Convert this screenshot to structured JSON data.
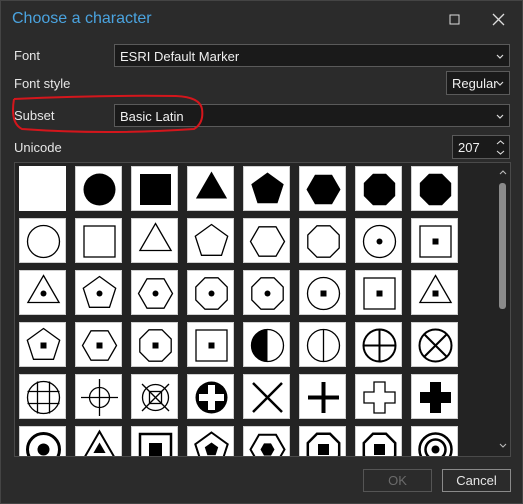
{
  "window": {
    "title": "Choose a character",
    "accent_color": "#4aa3df",
    "buttons": [
      "maximize-icon",
      "close-icon"
    ]
  },
  "form": {
    "font": {
      "label": "Font",
      "value": "ESRI Default Marker"
    },
    "font_style": {
      "label": "Font style",
      "value": "Regular"
    },
    "subset": {
      "label": "Subset",
      "value": "Basic Latin",
      "annotation_color": "#d4161c"
    },
    "unicode": {
      "label": "Unicode",
      "value": "207"
    }
  },
  "glyph_grid": {
    "columns": 9,
    "rows": [
      [
        "square-filled-white",
        "circle-filled",
        "square-filled",
        "triangle-filled",
        "pentagon-filled",
        "hexagon-filled",
        "octagon-filled",
        "octagon-filled-2"
      ],
      [
        "circle-outline",
        "square-outline",
        "triangle-outline",
        "pentagon-outline",
        "hexagon-outline",
        "octagon-outline",
        "circle-dot",
        "square-dot"
      ],
      [
        "triangle-dot",
        "pentagon-dot",
        "hexagon-dot",
        "octagon-dot",
        "octagon-dot-2",
        "circle-square",
        "square-square",
        "triangle-square"
      ],
      [
        "pentagon-square",
        "hexagon-square",
        "octagon-square",
        "square-square-2",
        "circle-half",
        "circle-vline",
        "circle-cross",
        "circle-x"
      ],
      [
        "circle-grid",
        "crosshair",
        "circle-x-square",
        "circle-cross-filled",
        "x-mark",
        "plus",
        "cross-outline",
        "cross-filled"
      ],
      [
        "circle-bullseye",
        "triangle-triangle",
        "square-square-filled",
        "pentagon-pentagon",
        "hexagon-hexagon",
        "octagon-square-filled",
        "octagon-square-2",
        "circle-rings"
      ]
    ]
  },
  "buttons": {
    "ok": "OK",
    "cancel": "Cancel"
  }
}
